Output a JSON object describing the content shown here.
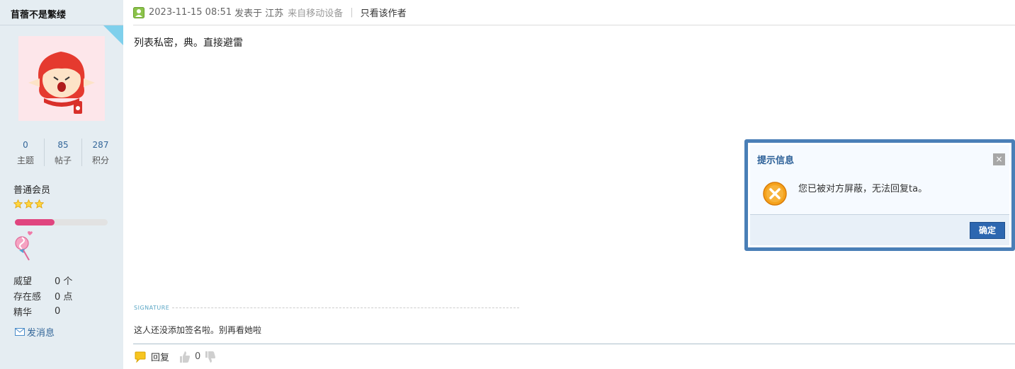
{
  "sidebar": {
    "username": "苜蓿不是繁缕",
    "stats": [
      {
        "value": "0",
        "label": "主题"
      },
      {
        "value": "85",
        "label": "帖子"
      },
      {
        "value": "287",
        "label": "积分"
      }
    ],
    "group": "普通会员",
    "star_count": 3,
    "level_progress": 0.43,
    "info": [
      {
        "key": "威望",
        "value": "0 个"
      },
      {
        "key": "存在感",
        "value": "0 点"
      },
      {
        "key": "精华",
        "value": "0"
      }
    ],
    "send_message": "发消息"
  },
  "post": {
    "timestamp": "2023-11-15 08:51",
    "posted_in": "发表于 江苏",
    "device": "来自移动设备",
    "only_author": "只看该作者",
    "content": "列表私密，典。直接避雷",
    "signature_label": "SIGNATURE",
    "signature": "这人还没添加签名啦。别再看她啦",
    "reply": "回复",
    "like_count": "0"
  },
  "dialog": {
    "title": "提示信息",
    "message": "您已被对方屏蔽，无法回复ta。",
    "ok": "确定",
    "close": "×"
  },
  "colors": {
    "sidebar_bg": "#e5edf2",
    "link": "#336699",
    "dialog_border": "#4a7fb7",
    "ok_button": "#2d67b0",
    "progress": "#e0457f"
  }
}
